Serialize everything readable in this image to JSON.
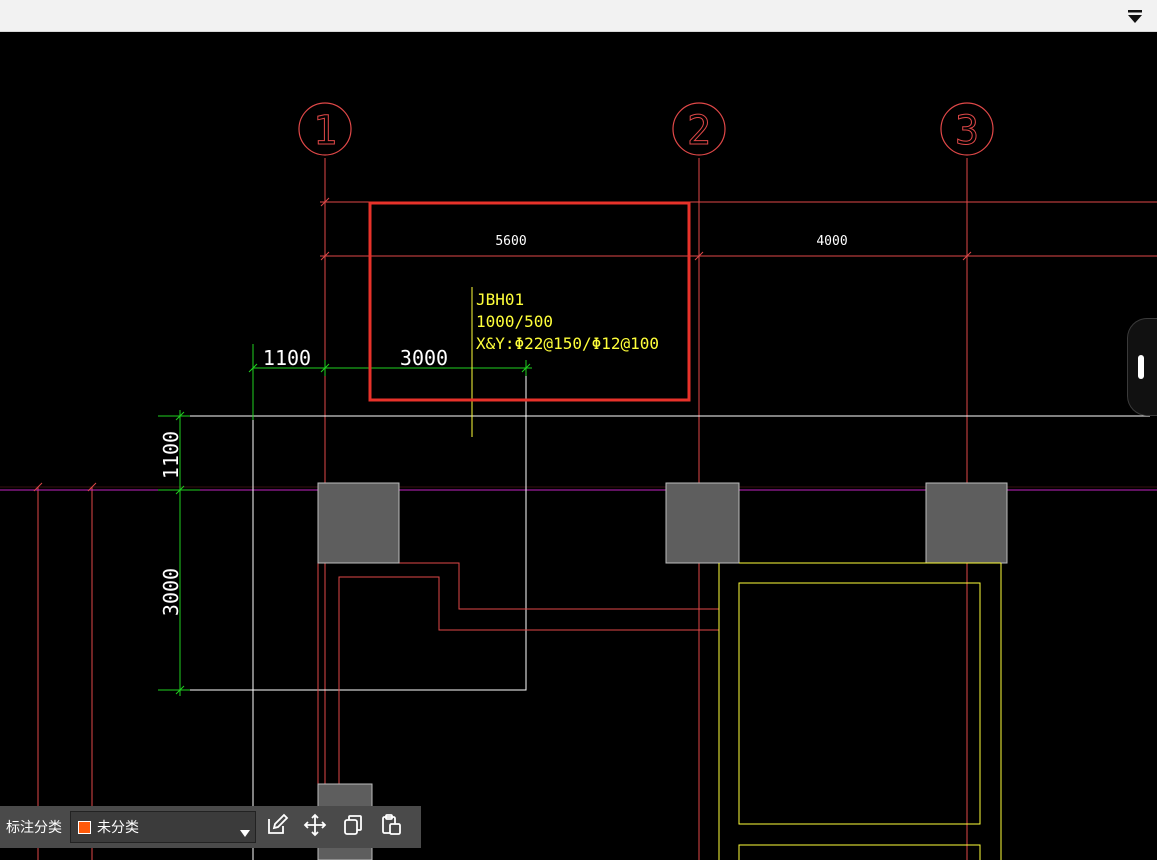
{
  "colors": {
    "axis_red": "#e04848",
    "grid_magenta": "#c224c2",
    "dim_green": "#1fd11f",
    "note_yellow": "#ffff3a",
    "highlight_red": "#e8322a",
    "column_gray": "#5e5e5e",
    "category_swatch": "#ff5a0a"
  },
  "axes": [
    {
      "id": "axis-1",
      "label": "1"
    },
    {
      "id": "axis-2",
      "label": "2"
    },
    {
      "id": "axis-3",
      "label": "3"
    }
  ],
  "dimensions": {
    "top_span_1": "5600",
    "top_span_2": "4000",
    "green_left": "1100",
    "green_right": "3000",
    "vertical_top": "1100",
    "vertical_bottom": "3000"
  },
  "annotation": {
    "name": "JBH01",
    "size": "1000/500",
    "rebar": "X&Y:Φ22@150/Φ12@100"
  },
  "toolbar": {
    "label": "标注分类",
    "category_value": "未分类",
    "edit_icon": "edit-icon",
    "move_icon": "move-icon",
    "copy_icon": "copy-icon",
    "paste_icon": "paste-icon"
  }
}
